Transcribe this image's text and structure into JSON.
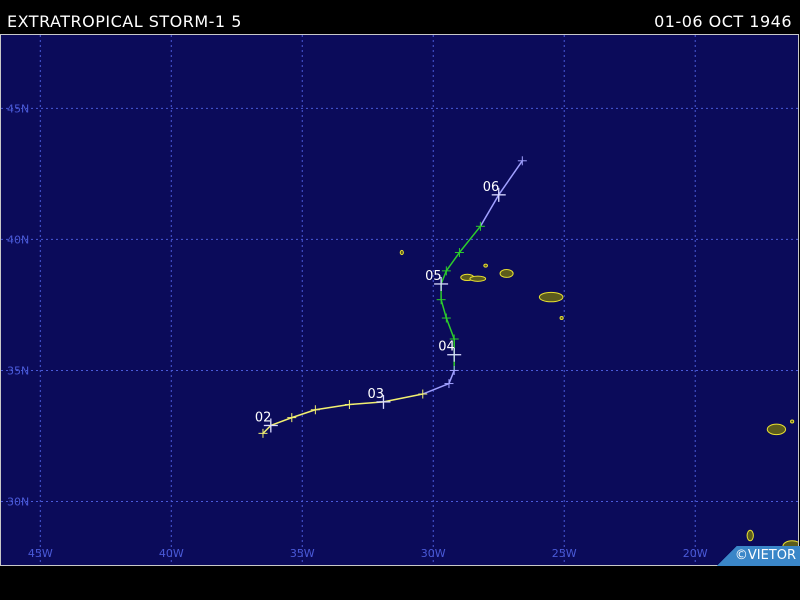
{
  "header": {
    "title": "EXTRATROPICAL STORM-1 5",
    "dates": "01-06 OCT 1946"
  },
  "credit": "©VIETOR",
  "map": {
    "lon_range": [
      -46.5,
      -16
    ],
    "lat_range": [
      27.5,
      47.8
    ],
    "lon_ticks": [
      {
        "value": -45,
        "label": "45W"
      },
      {
        "value": -40,
        "label": "40W"
      },
      {
        "value": -35,
        "label": "35W"
      },
      {
        "value": -30,
        "label": "30W"
      },
      {
        "value": -25,
        "label": "25W"
      },
      {
        "value": -20,
        "label": "20W"
      }
    ],
    "lat_ticks": [
      {
        "value": 45,
        "label": "45N"
      },
      {
        "value": 40,
        "label": "40N"
      },
      {
        "value": 35,
        "label": "35N"
      },
      {
        "value": 30,
        "label": "30N"
      }
    ],
    "colors": {
      "ocean": "#0b0b5a",
      "grid": "#4a5ad8",
      "axis_label": "#4a5ad8",
      "land_fill": "#5c5c1c",
      "coast": "#e8e030",
      "day_label": "#ffffff"
    },
    "track": [
      {
        "lon": -36.5,
        "lat": 32.6,
        "color": "#f2f070"
      },
      {
        "lon": -36.2,
        "lat": 32.9,
        "color": "#f2f070"
      },
      {
        "lon": -35.4,
        "lat": 33.2,
        "color": "#f2f070"
      },
      {
        "lon": -34.5,
        "lat": 33.5,
        "color": "#f2f070"
      },
      {
        "lon": -33.2,
        "lat": 33.7,
        "color": "#f2f070"
      },
      {
        "lon": -31.9,
        "lat": 33.8,
        "color": "#f2f070"
      },
      {
        "lon": -30.4,
        "lat": 34.1,
        "color": "#f2f070"
      },
      {
        "lon": -29.4,
        "lat": 34.5,
        "color": "#a0a0ff"
      },
      {
        "lon": -29.2,
        "lat": 35.0,
        "color": "#a0a0ff"
      },
      {
        "lon": -29.2,
        "lat": 35.6,
        "color": "#2ccc2c"
      },
      {
        "lon": -29.2,
        "lat": 36.2,
        "color": "#2ccc2c"
      },
      {
        "lon": -29.5,
        "lat": 37.0,
        "color": "#2ccc2c"
      },
      {
        "lon": -29.7,
        "lat": 37.7,
        "color": "#2ccc2c"
      },
      {
        "lon": -29.7,
        "lat": 38.3,
        "color": "#2ccc2c"
      },
      {
        "lon": -29.5,
        "lat": 38.8,
        "color": "#2ccc2c"
      },
      {
        "lon": -29.0,
        "lat": 39.5,
        "color": "#2ccc2c"
      },
      {
        "lon": -28.2,
        "lat": 40.5,
        "color": "#2ccc2c"
      },
      {
        "lon": -27.5,
        "lat": 41.7,
        "color": "#a0a0ff"
      },
      {
        "lon": -26.6,
        "lat": 43.0,
        "color": "#a0a0ff"
      }
    ],
    "day_markers": [
      {
        "label": "02",
        "lon": -36.2,
        "lat": 32.9
      },
      {
        "label": "03",
        "lon": -31.9,
        "lat": 33.8
      },
      {
        "label": "04",
        "lon": -29.2,
        "lat": 35.6
      },
      {
        "label": "05",
        "lon": -29.7,
        "lat": 38.3
      },
      {
        "label": "06",
        "lon": -27.5,
        "lat": 41.7
      }
    ],
    "islands": [
      {
        "name": "flores",
        "lon": -31.2,
        "lat": 39.5,
        "rx": 0.06,
        "ry": 0.08
      },
      {
        "name": "graciosa",
        "lon": -28.0,
        "lat": 39.0,
        "rx": 0.07,
        "ry": 0.05
      },
      {
        "name": "faial",
        "lon": -28.7,
        "lat": 38.55,
        "rx": 0.25,
        "ry": 0.12
      },
      {
        "name": "pico",
        "lon": -28.3,
        "lat": 38.5,
        "rx": 0.3,
        "ry": 0.1
      },
      {
        "name": "terceira",
        "lon": -27.2,
        "lat": 38.7,
        "rx": 0.25,
        "ry": 0.15
      },
      {
        "name": "sao-miguel",
        "lon": -25.5,
        "lat": 37.8,
        "rx": 0.45,
        "ry": 0.18
      },
      {
        "name": "santa-maria",
        "lon": -25.1,
        "lat": 37.0,
        "rx": 0.06,
        "ry": 0.05
      },
      {
        "name": "madeira",
        "lon": -16.9,
        "lat": 32.75,
        "rx": 0.35,
        "ry": 0.2
      },
      {
        "name": "porto-santo",
        "lon": -16.3,
        "lat": 33.05,
        "rx": 0.06,
        "ry": 0.05
      },
      {
        "name": "la-palma",
        "lon": -17.9,
        "lat": 28.7,
        "rx": 0.12,
        "ry": 0.2
      },
      {
        "name": "tenerife-west",
        "lon": -16.3,
        "lat": 28.3,
        "rx": 0.35,
        "ry": 0.2
      }
    ]
  }
}
